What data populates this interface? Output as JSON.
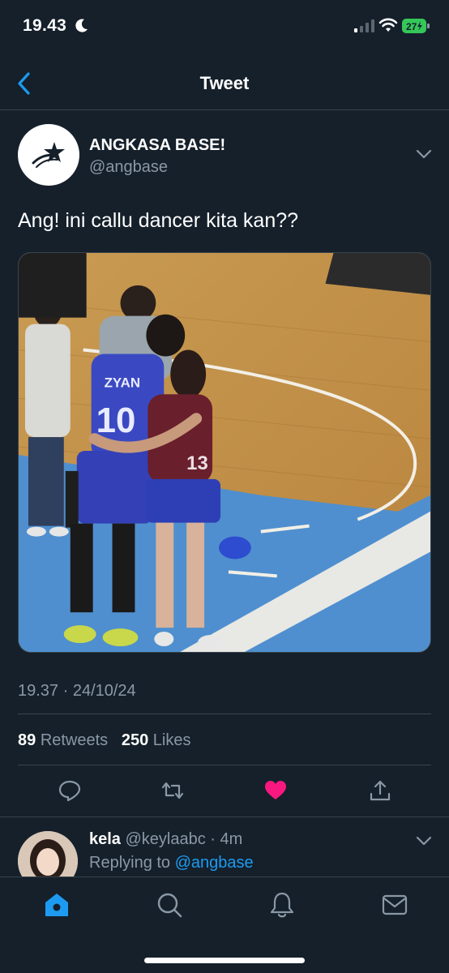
{
  "status_bar": {
    "time": "19.43",
    "battery": "27"
  },
  "nav": {
    "title": "Tweet",
    "back_icon": "chevron-left-icon"
  },
  "tweet": {
    "display_name": "ANGKASA BASE!",
    "handle": "@angbase",
    "text": "Ang! ini callu dancer kita kan??",
    "media_jersey_name": "ZYAN",
    "media_jersey_number": "10",
    "media_jersey_number_2": "13",
    "timestamp": "19.37 · 24/10/24",
    "retweets": "89",
    "retweets_label": "Retweets",
    "likes": "250",
    "likes_label": "Likes",
    "liked": true,
    "like_color": "#f91880"
  },
  "actions": [
    "reply-icon",
    "retweet-icon",
    "like-heart-icon",
    "share-icon"
  ],
  "reply": {
    "name": "kela",
    "handle_time": "@keylaabc · 4m",
    "replying_prefix": "Replying to",
    "replying_to": "@angbase"
  },
  "tab_bar": [
    "home-icon",
    "search-icon",
    "notifications-bell-icon",
    "messages-mail-icon"
  ],
  "colors": {
    "background": "#15202b",
    "accent": "#1d9bf0",
    "secondary_text": "#8b98a5",
    "divider": "#38444d"
  }
}
